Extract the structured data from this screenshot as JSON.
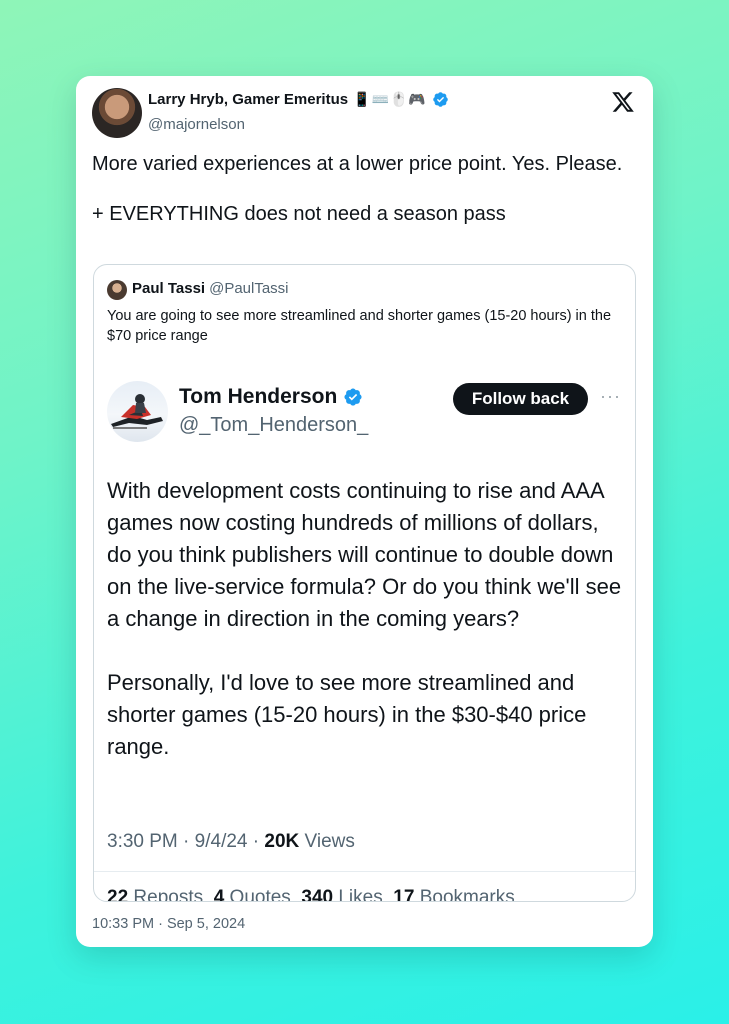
{
  "main_tweet": {
    "author_name": "Larry Hryb, Gamer Emeritus",
    "name_emojis": "📱⌨️🖱️🎮",
    "handle": "@majornelson",
    "text": "More varied experiences at a lower price point. Yes. Please.\n\n+ EVERYTHING does not need a season pass",
    "timestamp": "10:33 PM · Sep 5, 2024"
  },
  "quoted_tweet": {
    "author_name": "Paul Tassi",
    "handle": "@PaulTassi",
    "text": "You are going to see more streamlined and shorter games (15-20 hours) in the $70 price range"
  },
  "embedded_tweet": {
    "author_name": "Tom Henderson",
    "handle": "@_Tom_Henderson_",
    "follow_label": "Follow back",
    "more_label": "···",
    "text": "With development costs continuing to rise and AAA games now costing hundreds of millions of dollars, do you think publishers will continue to double down on the live-service formula? Or do you think we'll see a change in direction in the coming years?\n\nPersonally, I'd love to see more streamlined and shorter games (15-20 hours) in the $30-$40 price range.",
    "time": "3:30 PM",
    "date": "9/4/24",
    "views_count": "20K",
    "views_label": "Views",
    "stats": {
      "reposts_count": "22",
      "reposts_label": "Reposts",
      "quotes_count": "4",
      "quotes_label": "Quotes",
      "likes_count": "340",
      "likes_label": "Likes",
      "bookmarks_count": "17",
      "bookmarks_label": "Bookmarks"
    }
  },
  "colors": {
    "verified": "#1d9bf0",
    "text_primary": "#0f1419",
    "text_secondary": "#536471",
    "button_bg": "#0f1419"
  },
  "icons": [
    "x-logo-icon",
    "verified-badge-icon",
    "more-options-icon"
  ]
}
